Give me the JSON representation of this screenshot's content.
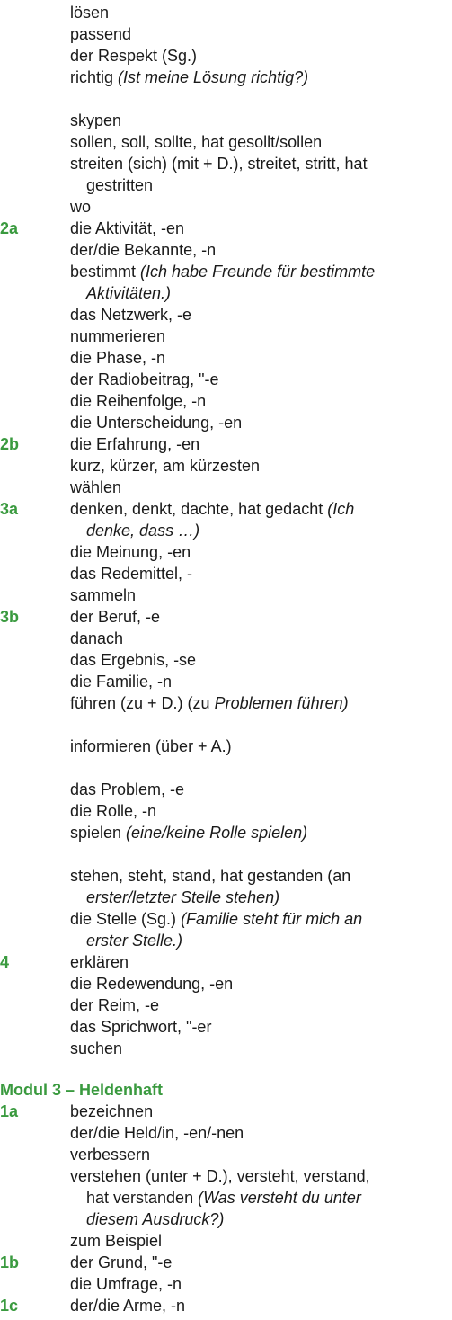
{
  "colors": {
    "accent": "#3a9a3f",
    "text": "#1a1a1a"
  },
  "rows": [
    {
      "parts": [
        {
          "t": "lösen"
        }
      ]
    },
    {
      "parts": [
        {
          "t": "passend"
        }
      ]
    },
    {
      "parts": [
        {
          "t": "der Respekt (Sg.)"
        }
      ]
    },
    {
      "parts": [
        {
          "t": "richtig "
        },
        {
          "t": "(Ist meine Lösung richtig?)",
          "i": true
        }
      ]
    },
    {
      "parts": [
        {
          "t": "skypen"
        }
      ]
    },
    {
      "parts": [
        {
          "t": "sollen, soll, sollte, hat gesollt/sollen"
        }
      ]
    },
    {
      "parts": [
        {
          "t": "streiten (sich) (mit + D.), streitet, stritt, hat"
        }
      ]
    },
    {
      "indent": true,
      "parts": [
        {
          "t": "gestritten"
        }
      ]
    },
    {
      "parts": [
        {
          "t": "wo"
        }
      ]
    },
    {
      "tag": "2a",
      "parts": [
        {
          "t": "die Aktivität, -en"
        }
      ]
    },
    {
      "parts": [
        {
          "t": "der/die Bekannte, -n"
        }
      ]
    },
    {
      "parts": [
        {
          "t": "bestimmt "
        },
        {
          "t": "(Ich habe Freunde für bestimmte",
          "i": true
        }
      ]
    },
    {
      "indent": true,
      "parts": [
        {
          "t": "Aktivitäten.)",
          "i": true
        }
      ]
    },
    {
      "parts": [
        {
          "t": "das Netzwerk, -e"
        }
      ]
    },
    {
      "parts": [
        {
          "t": "nummerieren"
        }
      ]
    },
    {
      "parts": [
        {
          "t": "die Phase, -n"
        }
      ]
    },
    {
      "parts": [
        {
          "t": "der Radiobeitrag, \"-e"
        }
      ]
    },
    {
      "parts": [
        {
          "t": "die Reihenfolge, -n"
        }
      ]
    },
    {
      "parts": [
        {
          "t": "die Unterscheidung, -en"
        }
      ]
    },
    {
      "tag": "2b",
      "parts": [
        {
          "t": "die Erfahrung, -en"
        }
      ]
    },
    {
      "parts": [
        {
          "t": "kurz, kürzer, am kürzesten"
        }
      ]
    },
    {
      "parts": [
        {
          "t": "wählen"
        }
      ]
    },
    {
      "tag": "3a",
      "parts": [
        {
          "t": "denken, denkt, dachte, hat gedacht "
        },
        {
          "t": "(Ich",
          "i": true
        }
      ]
    },
    {
      "indent": true,
      "parts": [
        {
          "t": "denke, dass …)",
          "i": true
        }
      ]
    },
    {
      "parts": [
        {
          "t": "die Meinung, -en"
        }
      ]
    },
    {
      "parts": [
        {
          "t": "das Redemittel, -"
        }
      ]
    },
    {
      "parts": [
        {
          "t": "sammeln"
        }
      ]
    },
    {
      "tag": "3b",
      "parts": [
        {
          "t": "der Beruf, -e"
        }
      ]
    },
    {
      "parts": [
        {
          "t": "danach"
        }
      ]
    },
    {
      "parts": [
        {
          "t": "das Ergebnis, -se"
        }
      ]
    },
    {
      "parts": [
        {
          "t": "die Familie, -n"
        }
      ]
    },
    {
      "parts": [
        {
          "t": "führen (zu + D.) (zu "
        },
        {
          "t": "Problemen führen)",
          "i": true
        }
      ]
    },
    {
      "parts": [
        {
          "t": "informieren (über + A.)"
        }
      ]
    },
    {
      "parts": [
        {
          "t": "das Problem, -e"
        }
      ]
    },
    {
      "parts": [
        {
          "t": "die Rolle, -n"
        }
      ]
    },
    {
      "parts": [
        {
          "t": "spielen "
        },
        {
          "t": "(eine/keine Rolle spielen)",
          "i": true
        }
      ]
    },
    {
      "parts": [
        {
          "t": "stehen, steht, stand, hat gestanden (an"
        }
      ]
    },
    {
      "indent": true,
      "parts": [
        {
          "t": "erster/letzter Stelle stehen)",
          "i": true
        }
      ]
    },
    {
      "parts": [
        {
          "t": "die Stelle (Sg.) "
        },
        {
          "t": "(Familie steht für mich an",
          "i": true
        }
      ]
    },
    {
      "indent": true,
      "parts": [
        {
          "t": "erster Stelle.)",
          "i": true
        }
      ]
    },
    {
      "tag": "4",
      "parts": [
        {
          "t": "erklären"
        }
      ]
    },
    {
      "parts": [
        {
          "t": "die Redewendung, -en"
        }
      ]
    },
    {
      "parts": [
        {
          "t": "der Reim, -e"
        }
      ]
    },
    {
      "parts": [
        {
          "t": "das Sprichwort, \"-er"
        }
      ]
    },
    {
      "parts": [
        {
          "t": "suchen"
        }
      ]
    },
    {
      "heading": "Modul 3 – Heldenhaft"
    },
    {
      "tag": "1a",
      "parts": [
        {
          "t": "bezeichnen"
        }
      ]
    },
    {
      "parts": [
        {
          "t": "der/die Held/in, -en/-nen"
        }
      ]
    },
    {
      "parts": [
        {
          "t": "verbessern"
        }
      ]
    },
    {
      "parts": [
        {
          "t": "verstehen (unter + D.), versteht, verstand,"
        }
      ]
    },
    {
      "indent": true,
      "parts": [
        {
          "t": "hat verstanden "
        },
        {
          "t": "(Was versteht du unter",
          "i": true
        }
      ]
    },
    {
      "indent": true,
      "parts": [
        {
          "t": "diesem Ausdruck?)",
          "i": true
        }
      ]
    },
    {
      "parts": [
        {
          "t": "zum Beispiel"
        }
      ]
    },
    {
      "tag": "1b",
      "parts": [
        {
          "t": "der Grund, \"-e"
        }
      ]
    },
    {
      "parts": [
        {
          "t": "die Umfrage, -n"
        }
      ]
    },
    {
      "tag": "1c",
      "parts": [
        {
          "t": "der/die Arme, -n"
        }
      ]
    }
  ]
}
